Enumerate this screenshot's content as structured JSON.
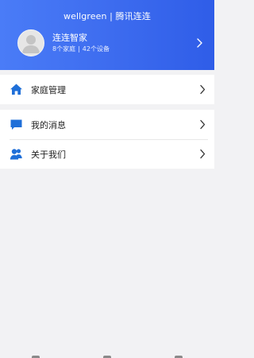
{
  "header": {
    "title": "wellgreen | 腾讯连连"
  },
  "profile": {
    "name": "连连智家",
    "family_count": "8个家庭",
    "separator": "|",
    "device_count": "42个设备"
  },
  "menu": {
    "family_management": {
      "label": "家庭管理",
      "icon": "home-icon"
    },
    "my_messages": {
      "label": "我的消息",
      "icon": "message-icon"
    },
    "about_us": {
      "label": "关于我们",
      "icon": "people-icon"
    }
  },
  "colors": {
    "header_gradient_start": "#4a7cf7",
    "header_gradient_end": "#2f5de8",
    "icon_blue": "#1f6fd8",
    "background": "#f2f2f4"
  }
}
